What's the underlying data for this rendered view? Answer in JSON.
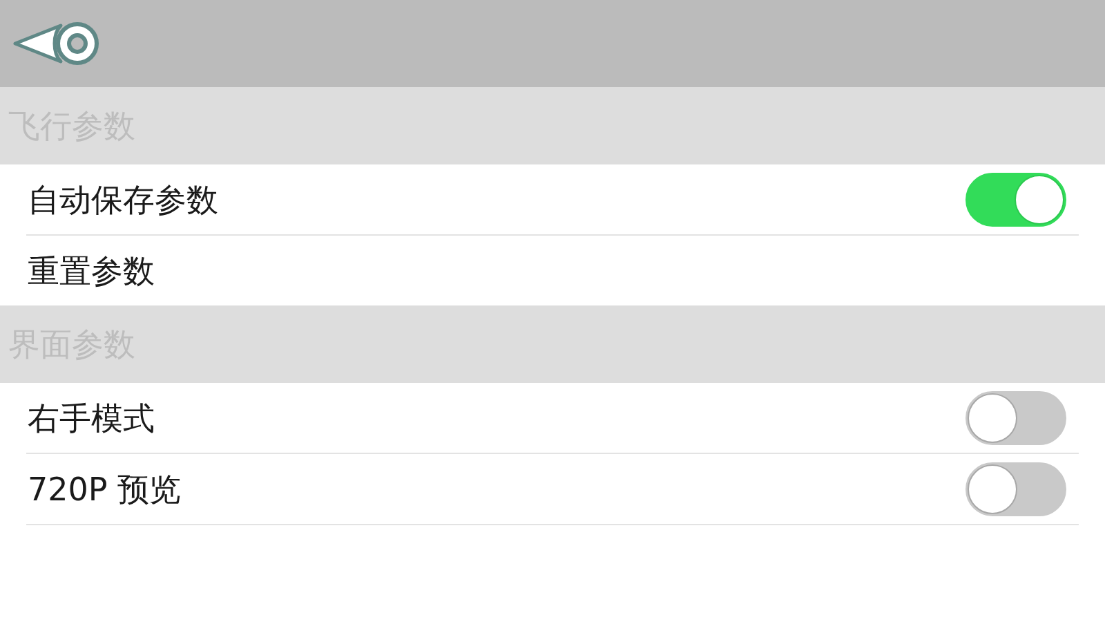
{
  "sections": [
    {
      "title": "飞行参数",
      "items": [
        {
          "kind": "toggle",
          "label": "自动保存参数",
          "on": true
        },
        {
          "kind": "action",
          "label": "重置参数"
        }
      ]
    },
    {
      "title": "界面参数",
      "items": [
        {
          "kind": "toggle",
          "label": "右手模式",
          "on": false
        },
        {
          "kind": "toggle",
          "label": "720P 预览",
          "on": false
        }
      ]
    }
  ]
}
